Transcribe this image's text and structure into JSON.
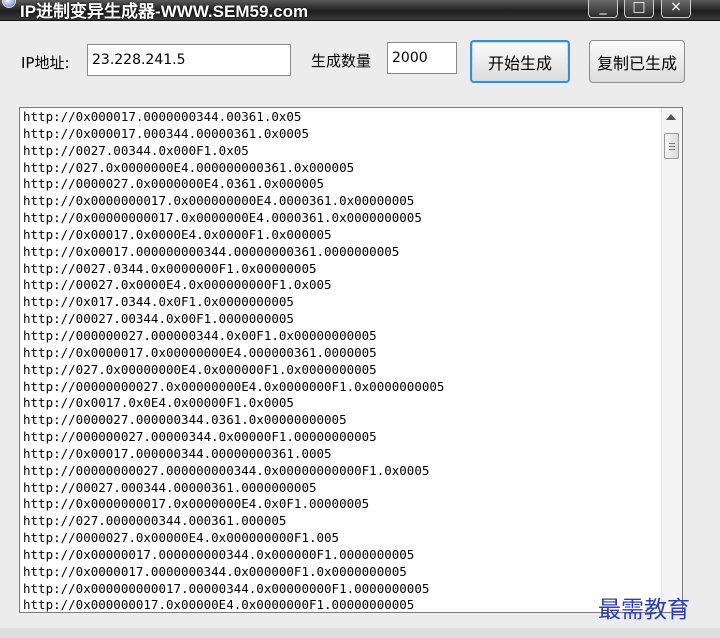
{
  "window": {
    "title": "IP进制变异生成器-WWW.SEM59.com",
    "controls": [
      "_",
      "□",
      "×"
    ]
  },
  "form": {
    "ip_label": "IP地址:",
    "ip_value": "23.228.241.5",
    "count_label": "生成数量",
    "count_value": "2000",
    "start_button": "开始生成",
    "copy_button": "复制已生成"
  },
  "output_lines": [
    "http://0x000017.0000000344.00361.0x05",
    "http://0x000017.000344.00000361.0x0005",
    "http://0027.00344.0x000F1.0x05",
    "http://027.0x0000000E4.000000000361.0x000005",
    "http://0000027.0x0000000E4.0361.0x000005",
    "http://0x0000000017.0x000000000E4.0000361.0x00000005",
    "http://0x00000000017.0x0000000E4.0000361.0x0000000005",
    "http://0x00017.0x0000E4.0x0000F1.0x000005",
    "http://0x00017.000000000344.00000000361.0000000005",
    "http://0027.0344.0x0000000F1.0x00000005",
    "http://00027.0x0000E4.0x000000000F1.0x005",
    "http://0x017.0344.0x0F1.0x0000000005",
    "http://00027.00344.0x00F1.0000000005",
    "http://000000027.000000344.0x00F1.0x00000000005",
    "http://0x0000017.0x00000000E4.000000361.0000005",
    "http://027.0x00000000E4.0x000000F1.0x0000000005",
    "http://00000000027.0x00000000E4.0x0000000F1.0x0000000005",
    "http://0x0017.0x0E4.0x00000F1.0x0005",
    "http://0000027.000000344.0361.0x00000000005",
    "http://000000027.00000344.0x00000F1.00000000005",
    "http://0x00017.000000344.00000000361.0005",
    "http://00000000027.000000000344.0x00000000000F1.0x0005",
    "http://00027.000344.00000361.0000000005",
    "http://0x0000000017.0x0000000E4.0x0F1.00000005",
    "http://027.0000000344.000361.000005",
    "http://0000027.0x00000E4.0x000000000F1.005",
    "http://0x00000017.000000000344.0x000000F1.0000000005",
    "http://0x0000017.0000000344.0x000000F1.0x0000000005",
    "http://0x000000000017.00000344.0x00000000F1.0000000005",
    "http://0x000000017.0x00000E4.0x0000000F1.00000000005"
  ],
  "watermark": "最需教育"
}
